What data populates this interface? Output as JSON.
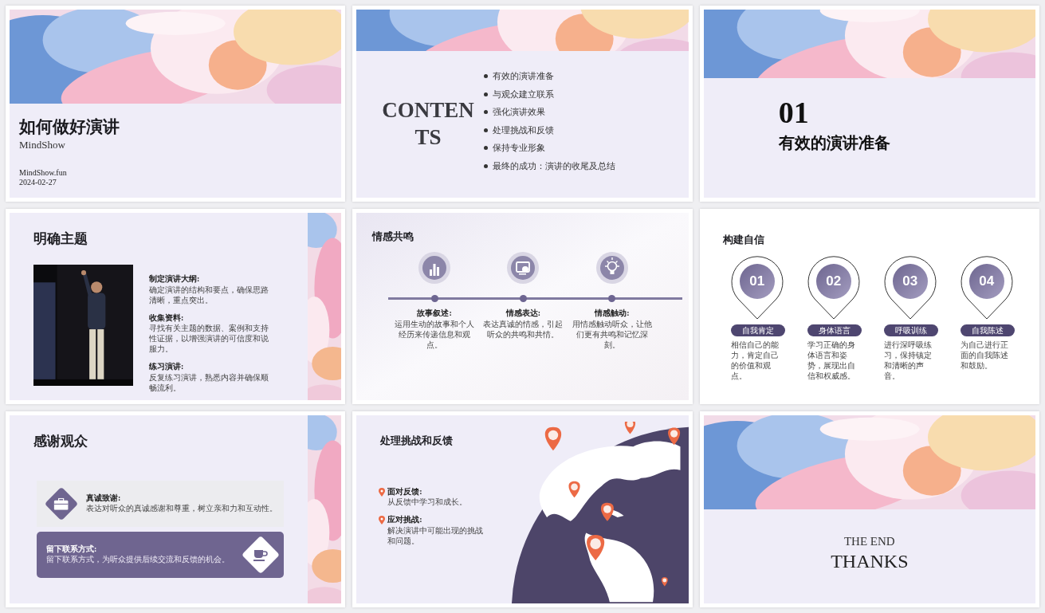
{
  "slides": [
    {
      "kind": "cover",
      "title": "如何做好演讲",
      "subtitle": "MindShow",
      "site": "MindShow.fun",
      "date": "2024-02-27"
    },
    {
      "kind": "contents",
      "heading_lines": [
        "CONTEN",
        "TS"
      ],
      "items": [
        "有效的演讲准备",
        "与观众建立联系",
        "强化演讲效果",
        "处理挑战和反馈",
        "保持专业形象",
        "最终的成功：演讲的收尾及总结"
      ]
    },
    {
      "kind": "section",
      "number": "01",
      "title": "有效的演讲准备"
    },
    {
      "kind": "photo_points",
      "title": "明确主题",
      "points": [
        {
          "label": "制定演讲大纲:",
          "text": "确定演讲的结构和要点，确保思路清晰，重点突出。"
        },
        {
          "label": "收集资料:",
          "text": "寻找有关主题的数据、案例和支持性证据，以增强演讲的可信度和说服力。"
        },
        {
          "label": "练习演讲:",
          "text": "反复练习演讲，熟悉内容并确保顺畅流利。"
        }
      ]
    },
    {
      "kind": "timeline",
      "title": "情感共鸣",
      "steps": [
        {
          "label": "故事叙述:",
          "text": "运用生动的故事和个人经历来传递信息和观点。"
        },
        {
          "label": "情感表达:",
          "text": "表达真诚的情感，引起听众的共鸣和共情。"
        },
        {
          "label": "情感触动:",
          "text": "用情感触动听众，让他们更有共鸣和记忆深刻。"
        }
      ]
    },
    {
      "kind": "badges",
      "title": "构建自信",
      "steps": [
        {
          "number": "01",
          "tag": "自我肯定",
          "text": "相信自己的能力，肯定自己的价值和观点。"
        },
        {
          "number": "02",
          "tag": "身体语言",
          "text": "学习正确的身体语言和姿势，展现出自信和权威感。"
        },
        {
          "number": "03",
          "tag": "呼吸训练",
          "text": "进行深呼吸练习，保持镇定和清晰的声音。"
        },
        {
          "number": "04",
          "tag": "自我陈述",
          "text": "为自己进行正面的自我陈述和鼓励。"
        }
      ]
    },
    {
      "kind": "cards",
      "title": "感谢观众",
      "cards": [
        {
          "label": "真诚致谢:",
          "text": "表达对听众的真诚感谢和尊重，树立亲和力和互动性。",
          "highlighted": false
        },
        {
          "label": "留下联系方式:",
          "text": "留下联系方式，为听众提供后续交流和反馈的机会。",
          "highlighted": true
        }
      ]
    },
    {
      "kind": "map",
      "title": "处理挑战和反馈",
      "points": [
        {
          "label": "面对反馈:",
          "text": "从反馈中学习和成长。"
        },
        {
          "label": "应对挑战:",
          "text": "解决演讲中可能出现的挑战和问题。"
        }
      ]
    },
    {
      "kind": "end",
      "lines": [
        "THE END",
        "THANKS"
      ]
    }
  ]
}
